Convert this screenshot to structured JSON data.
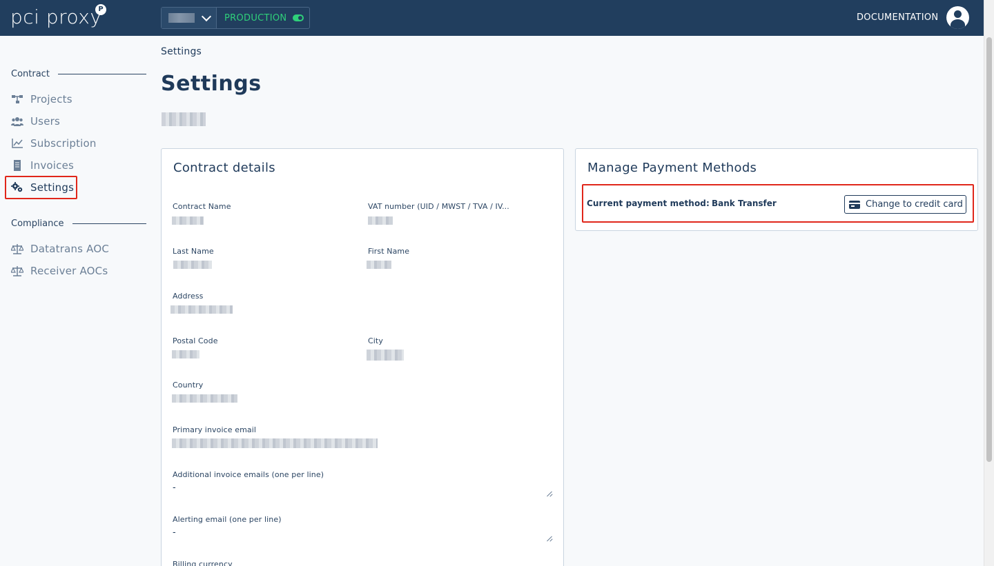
{
  "brand": {
    "logo": "pci proxy",
    "logo_badge": "P"
  },
  "topbar": {
    "environment_status": "PRODUCTION",
    "documentation_label": "DOCUMENTATION"
  },
  "sidebar": {
    "groups": [
      {
        "label": "Contract"
      },
      {
        "label": "Compliance"
      }
    ],
    "items": [
      {
        "label": "Projects"
      },
      {
        "label": "Users"
      },
      {
        "label": "Subscription"
      },
      {
        "label": "Invoices"
      },
      {
        "label": "Settings"
      },
      {
        "label": "Datatrans AOC"
      },
      {
        "label": "Receiver AOCs"
      }
    ],
    "active_item": "Settings"
  },
  "main": {
    "breadcrumb": "Settings",
    "title": "Settings"
  },
  "contract_details": {
    "title": "Contract details",
    "fields": {
      "contract_name": "Contract Name",
      "vat_number": "VAT number (UID / MWST / TVA / IV...",
      "last_name": "Last Name",
      "first_name": "First Name",
      "address": "Address",
      "postal_code": "Postal Code",
      "city": "City",
      "country": "Country",
      "primary_email": "Primary invoice email",
      "additional_emails": "Additional invoice emails (one per line)",
      "alerting_email": "Alerting email (one per line)",
      "billing_currency": "Billing currency"
    },
    "additional_emails_value": "-",
    "alerting_email_value": "-"
  },
  "payment": {
    "title": "Manage Payment Methods",
    "current_label": "Current payment method:",
    "current_value": "Bank Transfer",
    "change_button": "Change to credit card"
  },
  "colors": {
    "topbar": "#213e5e",
    "accent_green": "#2fd07a",
    "highlight_red": "#e0261a",
    "text_primary": "#1f3a5a"
  }
}
